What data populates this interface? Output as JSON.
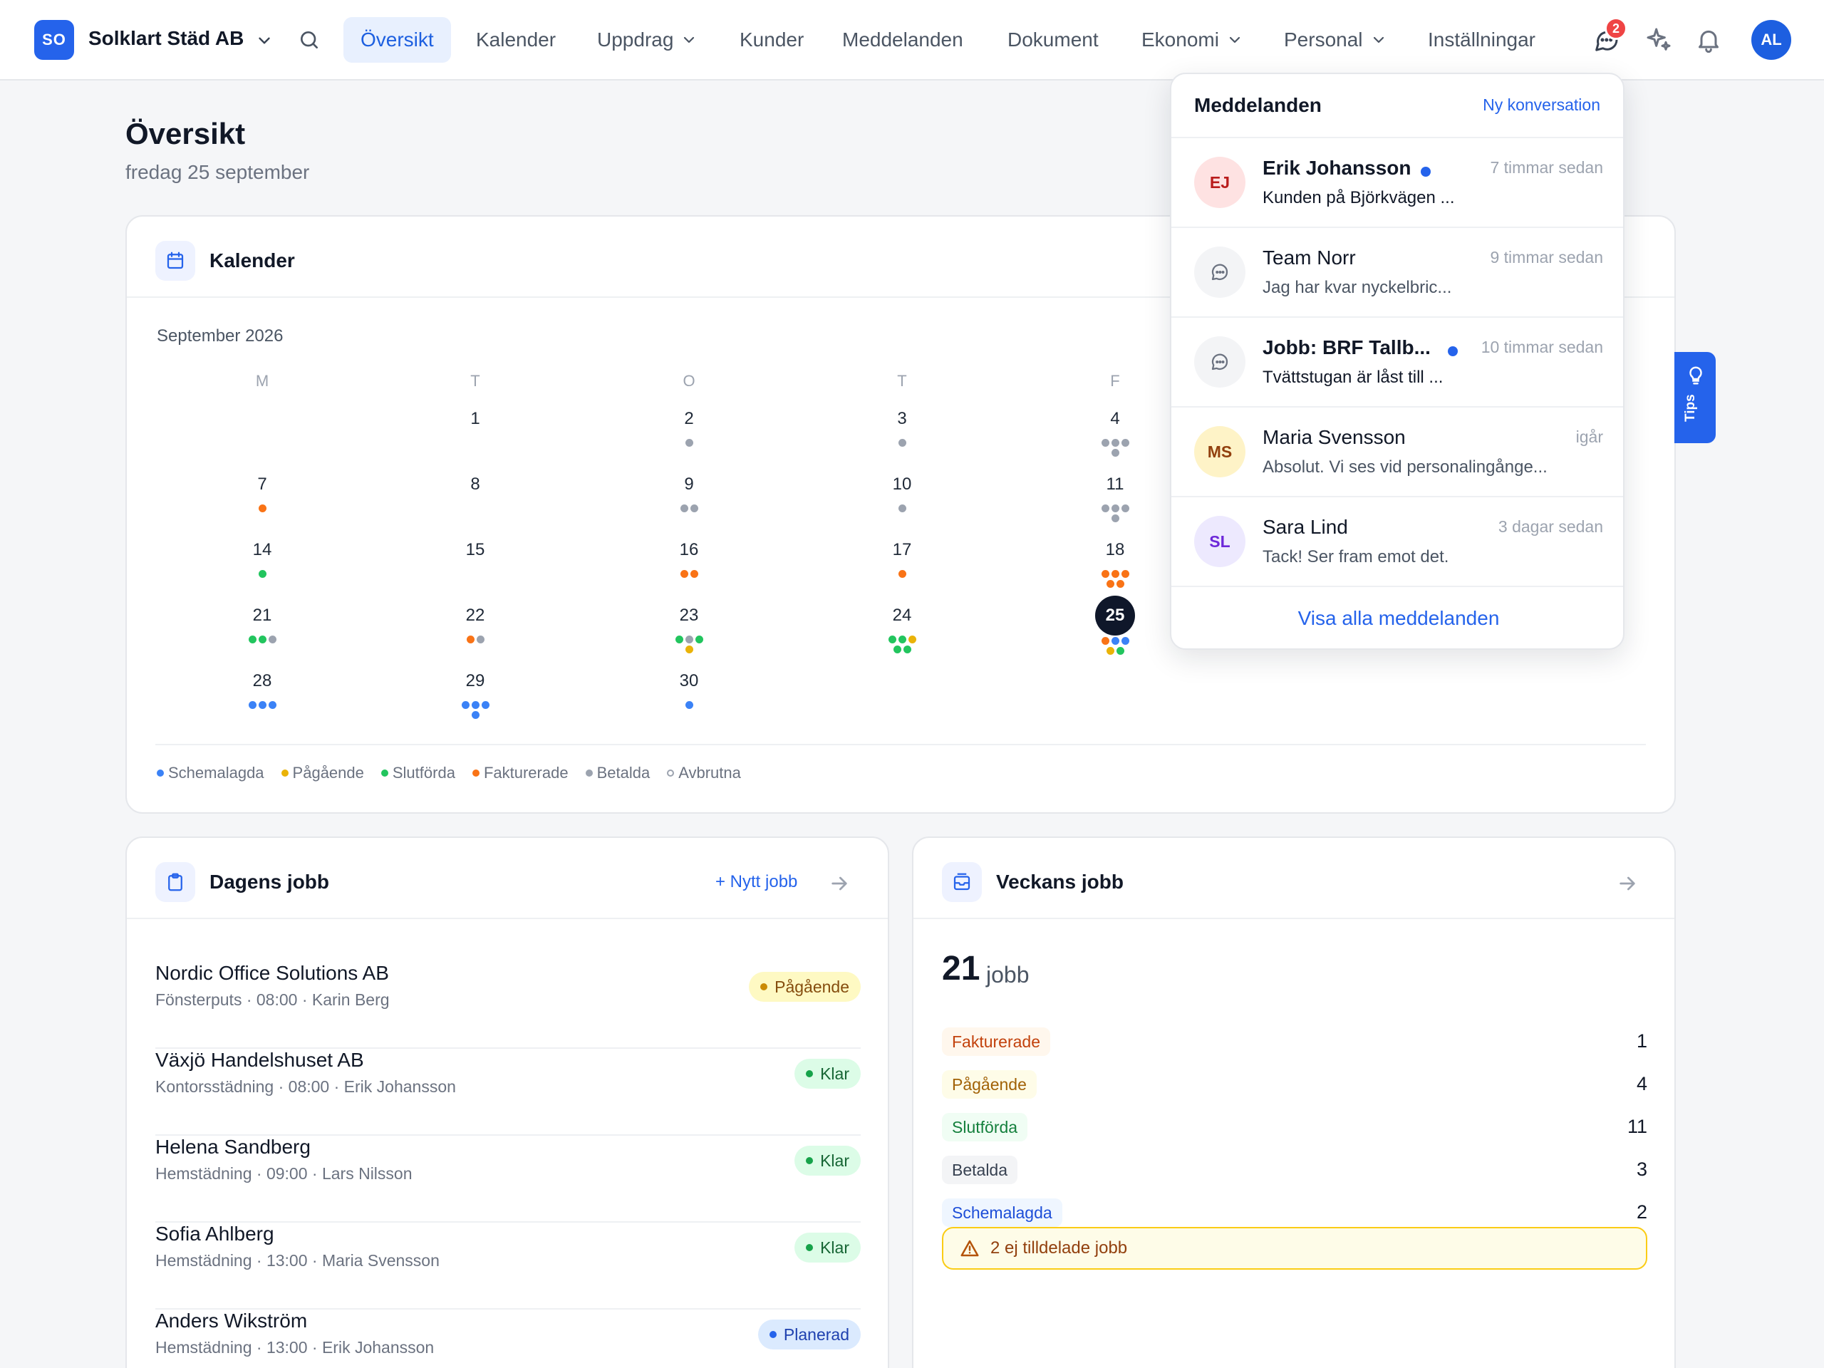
{
  "brand": {
    "initials": "SO",
    "name": "Solklart Städ AB"
  },
  "nav": [
    {
      "label": "Översikt",
      "active": true,
      "dropdown": false
    },
    {
      "label": "Kalender",
      "active": false,
      "dropdown": false
    },
    {
      "label": "Uppdrag",
      "active": false,
      "dropdown": true
    },
    {
      "label": "Kunder",
      "active": false,
      "dropdown": false
    },
    {
      "label": "Meddelanden",
      "active": false,
      "dropdown": false
    },
    {
      "label": "Dokument",
      "active": false,
      "dropdown": false
    },
    {
      "label": "Ekonomi",
      "active": false,
      "dropdown": true
    },
    {
      "label": "Personal",
      "active": false,
      "dropdown": true
    },
    {
      "label": "Inställningar",
      "active": false,
      "dropdown": false
    }
  ],
  "topbar": {
    "message_count": "2",
    "user_initials": "AL"
  },
  "page": {
    "title": "Översikt",
    "subtitle": "fredag 25 september"
  },
  "calendar": {
    "title": "Kalender",
    "month": "September 2026",
    "weekdays": [
      "M",
      "T",
      "O",
      "T",
      "F"
    ],
    "today": "25",
    "days": [
      {
        "num": "1",
        "dots": []
      },
      {
        "num": "2",
        "dots": [
          "betalda"
        ]
      },
      {
        "num": "3",
        "dots": [
          "betalda"
        ]
      },
      {
        "num": "4",
        "dots": [
          "betalda",
          "betalda",
          "betalda",
          "betalda"
        ]
      },
      {
        "num": "7",
        "dots": [
          "fakturerade"
        ]
      },
      {
        "num": "8",
        "dots": []
      },
      {
        "num": "9",
        "dots": [
          "betalda",
          "betalda"
        ]
      },
      {
        "num": "10",
        "dots": [
          "betalda"
        ]
      },
      {
        "num": "11",
        "dots": [
          "betalda",
          "betalda",
          "betalda",
          "betalda"
        ]
      },
      {
        "num": "14",
        "dots": [
          "slutforda"
        ]
      },
      {
        "num": "15",
        "dots": []
      },
      {
        "num": "16",
        "dots": [
          "fakturerade",
          "fakturerade"
        ]
      },
      {
        "num": "17",
        "dots": [
          "fakturerade"
        ]
      },
      {
        "num": "18",
        "dots": [
          "fakturerade",
          "fakturerade",
          "fakturerade",
          "fakturerade",
          "fakturerade"
        ]
      },
      {
        "num": "21",
        "dots": [
          "slutforda",
          "slutforda",
          "betalda"
        ]
      },
      {
        "num": "22",
        "dots": [
          "fakturerade",
          "betalda"
        ]
      },
      {
        "num": "23",
        "dots": [
          "slutforda",
          "betalda",
          "slutforda",
          "pagaende"
        ]
      },
      {
        "num": "24",
        "dots": [
          "slutforda",
          "slutforda",
          "pagaende",
          "slutforda",
          "slutforda"
        ]
      },
      {
        "num": "25",
        "dots": [
          "fakturerade",
          "schemalagda",
          "schemalagda",
          "pagaende",
          "slutforda"
        ]
      },
      {
        "num": "28",
        "dots": [
          "schemalagda",
          "schemalagda",
          "schemalagda"
        ]
      },
      {
        "num": "29",
        "dots": [
          "schemalagda",
          "schemalagda",
          "schemalagda",
          "schemalagda"
        ]
      },
      {
        "num": "30",
        "dots": [
          "schemalagda"
        ]
      }
    ],
    "legend": [
      {
        "key": "schemalagda",
        "label": "Schemalagda"
      },
      {
        "key": "pagaende",
        "label": "Pågående"
      },
      {
        "key": "slutforda",
        "label": "Slutförda"
      },
      {
        "key": "fakturerade",
        "label": "Fakturerade"
      },
      {
        "key": "betalda",
        "label": "Betalda"
      },
      {
        "key": "avbrutna",
        "label": "Avbrutna"
      }
    ]
  },
  "status_colors": {
    "schemalagda": "#3b82f6",
    "pagaende": "#eab308",
    "slutforda": "#22c55e",
    "fakturerade": "#f97316",
    "betalda": "#9ca3af",
    "avbrutna": "#9ca3af"
  },
  "todays_jobs": {
    "title": "Dagens jobb",
    "new_label": "+ Nytt jobb",
    "rows": [
      {
        "name": "Nordic Office Solutions AB",
        "meta": "Fönsterputs · 08:00 · Karin Berg",
        "status": "Pågående",
        "kind": "pagaende"
      },
      {
        "name": "Växjö Handelshuset AB",
        "meta": "Kontorsstädning · 08:00 · Erik Johansson",
        "status": "Klar",
        "kind": "klar"
      },
      {
        "name": "Helena Sandberg",
        "meta": "Hemstädning · 09:00 · Lars Nilsson",
        "status": "Klar",
        "kind": "klar"
      },
      {
        "name": "Sofia Ahlberg",
        "meta": "Hemstädning · 13:00 · Maria Svensson",
        "status": "Klar",
        "kind": "klar"
      },
      {
        "name": "Anders Wikström",
        "meta": "Hemstädning · 13:00 · Erik Johansson",
        "status": "Planerad",
        "kind": "planerad"
      }
    ]
  },
  "weekly_jobs": {
    "title": "Veckans jobb",
    "total": "21",
    "unit": "jobb",
    "stats": [
      {
        "label": "Fakturerade",
        "value": "1",
        "kind": "fakturerade"
      },
      {
        "label": "Pågående",
        "value": "4",
        "kind": "pagaende"
      },
      {
        "label": "Slutförda",
        "value": "11",
        "kind": "slutforda"
      },
      {
        "label": "Betalda",
        "value": "3",
        "kind": "betalda"
      },
      {
        "label": "Schemalagda",
        "value": "2",
        "kind": "schemalagda"
      }
    ],
    "warning": "2 ej tilldelade jobb"
  },
  "messages": {
    "title": "Meddelanden",
    "new_link": "Ny konversation",
    "footer": "Visa alla meddelanden",
    "items": [
      {
        "avatar": "EJ",
        "avatar_kind": "red",
        "name": "Erik Johansson",
        "unread": true,
        "time": "7 timmar sedan",
        "preview": "Kunden på Björkvägen ..."
      },
      {
        "avatar": "",
        "avatar_kind": "chat",
        "name": "Team Norr",
        "unread": false,
        "time": "9 timmar sedan",
        "preview": "Jag har kvar nyckelbric..."
      },
      {
        "avatar": "",
        "avatar_kind": "chat",
        "name": "Jobb: BRF Tallb...",
        "unread": true,
        "time": "10 timmar sedan",
        "preview": "Tvättstugan är låst till ..."
      },
      {
        "avatar": "MS",
        "avatar_kind": "yellow",
        "name": "Maria Svensson",
        "unread": false,
        "time": "igår",
        "preview": "Absolut. Vi ses vid personalingånge..."
      },
      {
        "avatar": "SL",
        "avatar_kind": "purple",
        "name": "Sara Lind",
        "unread": false,
        "time": "3 dagar sedan",
        "preview": "Tack! Ser fram emot det."
      }
    ]
  },
  "tips": {
    "label": "Tips"
  }
}
